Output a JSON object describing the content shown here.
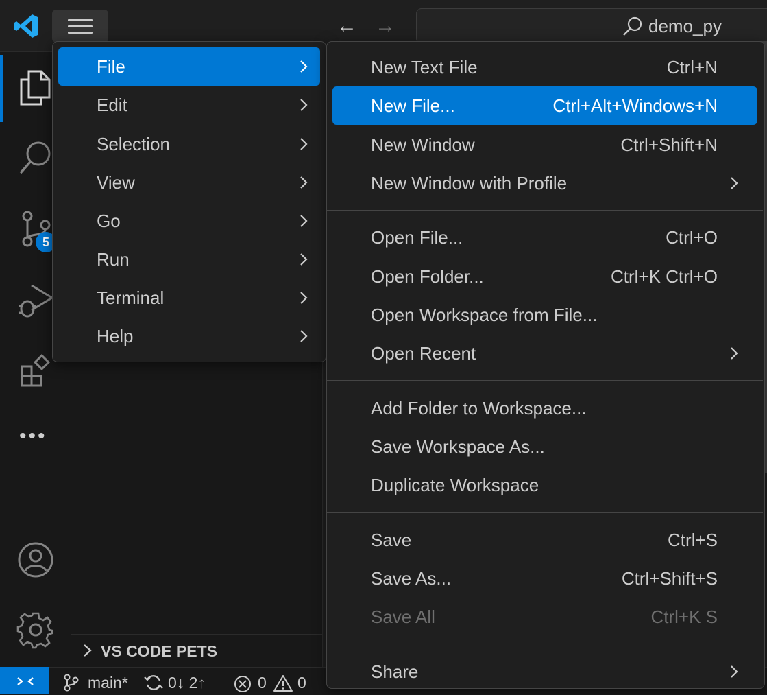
{
  "titlebar": {
    "search_text": "demo_py"
  },
  "sidebar": {
    "scm_badge": "5",
    "pets_label": "VS CODE PETS"
  },
  "statusbar": {
    "branch": "main*",
    "sync": "0↓ 2↑",
    "errors": "0",
    "warnings": "0"
  },
  "main_menu": {
    "items": [
      {
        "label": "File"
      },
      {
        "label": "Edit"
      },
      {
        "label": "Selection"
      },
      {
        "label": "View"
      },
      {
        "label": "Go"
      },
      {
        "label": "Run"
      },
      {
        "label": "Terminal"
      },
      {
        "label": "Help"
      }
    ]
  },
  "file_menu": {
    "items": [
      {
        "label": "New Text File",
        "shortcut": "Ctrl+N"
      },
      {
        "label": "New File...",
        "shortcut": "Ctrl+Alt+Windows+N"
      },
      {
        "label": "New Window",
        "shortcut": "Ctrl+Shift+N"
      },
      {
        "label": "New Window with Profile",
        "shortcut": ""
      },
      {
        "label": "Open File...",
        "shortcut": "Ctrl+O"
      },
      {
        "label": "Open Folder...",
        "shortcut": "Ctrl+K Ctrl+O"
      },
      {
        "label": "Open Workspace from File...",
        "shortcut": ""
      },
      {
        "label": "Open Recent",
        "shortcut": ""
      },
      {
        "label": "Add Folder to Workspace...",
        "shortcut": ""
      },
      {
        "label": "Save Workspace As...",
        "shortcut": ""
      },
      {
        "label": "Duplicate Workspace",
        "shortcut": ""
      },
      {
        "label": "Save",
        "shortcut": "Ctrl+S"
      },
      {
        "label": "Save As...",
        "shortcut": "Ctrl+Shift+S"
      },
      {
        "label": "Save All",
        "shortcut": "Ctrl+K S"
      },
      {
        "label": "Share",
        "shortcut": ""
      }
    ]
  },
  "colors": {
    "accent": "#0078d4",
    "background": "#181818",
    "menu_background": "#1f1f1f"
  }
}
